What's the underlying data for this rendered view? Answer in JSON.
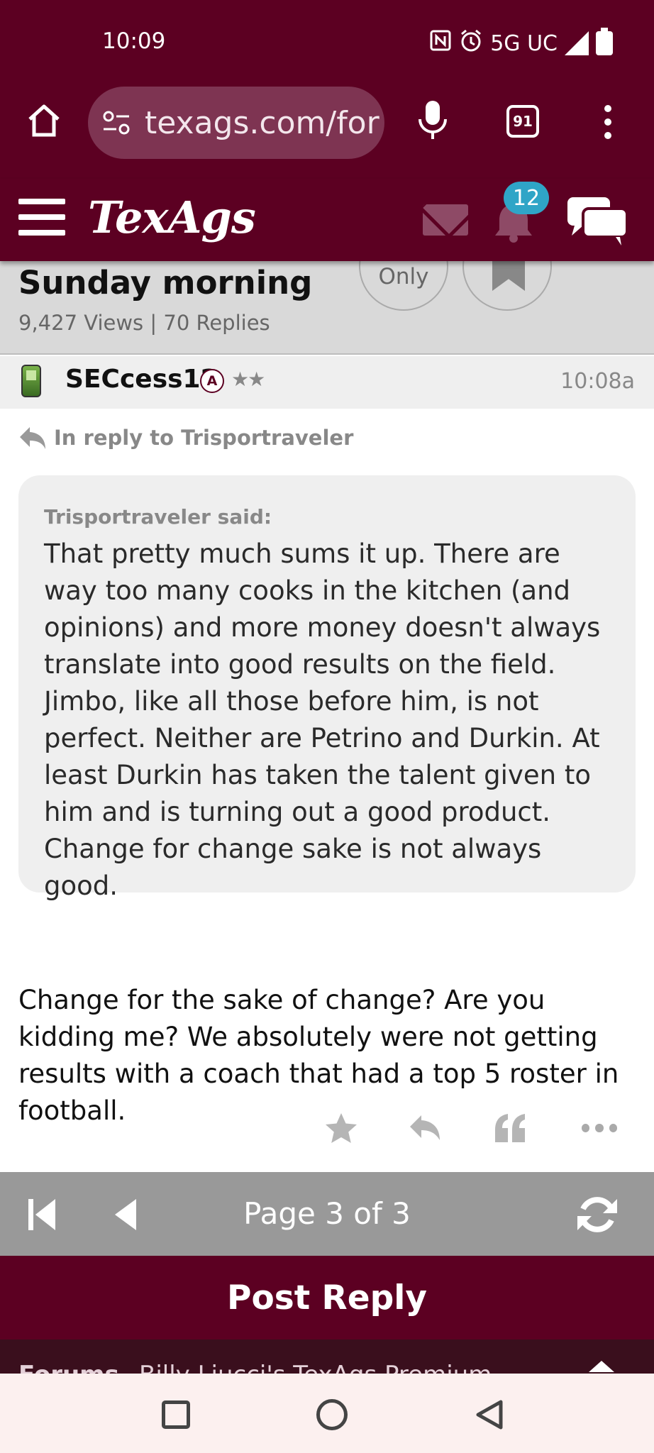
{
  "status_bar": {
    "time": "10:09",
    "network": "5G UC"
  },
  "browser": {
    "url": "texags.com/for",
    "tab_count": "91"
  },
  "site": {
    "logo": "TexAgs",
    "notification_count": "12"
  },
  "thread": {
    "title": "Sunday morning",
    "meta": "9,427 Views | 70 Replies",
    "only_label": "Only"
  },
  "post": {
    "username": "SECcess12",
    "badge": "A",
    "stars": "★★",
    "time": "10:08a",
    "reply_to": "In reply to Trisportraveler",
    "quote_author": "Trisportraveler said:",
    "quote_text": "That pretty much sums it up. There are way too many cooks in the kitchen (and opinions) and more money doesn't always translate into good results on the field. Jimbo, like all those before him, is not perfect. Neither are Petrino and Durkin. At least Durkin has taken the talent given to him and is turning out a good product. Change for change sake is not always good.",
    "body": "Change for the sake of change? Are you kidding me? We absolutely were not getting results with a coach that had a top 5 roster in football."
  },
  "pager": {
    "label": "Page 3 of 3"
  },
  "post_reply": {
    "label": "Post Reply"
  },
  "breadcrumb": {
    "forums": "Forums",
    "board": "Billy Liucci's TexAgs Premium"
  },
  "colors": {
    "maroon": "#5c0022",
    "badge_blue": "#2fa5c7",
    "pager_gray": "#999999"
  }
}
